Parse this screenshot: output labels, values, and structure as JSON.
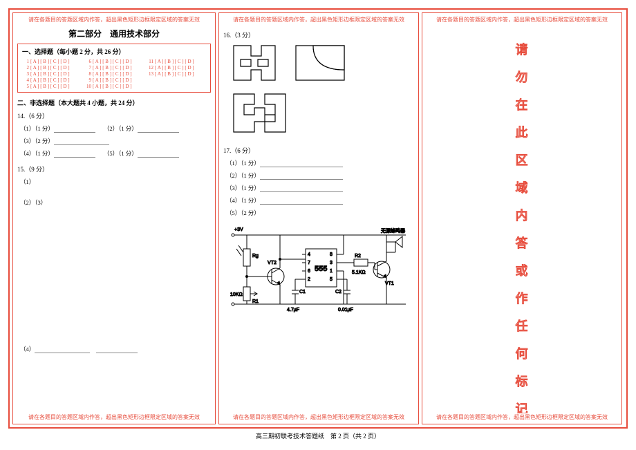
{
  "warn_text": "请在各题目的答题区域内作答，超出黑色矩形边框限定区域的答案无效",
  "panel1": {
    "section_title": "第二部分　通用技术部分",
    "mc_title": "一、选择题（每小题 2 分，共 26 分）",
    "option_bubble": "[ A ] [ B ] [ C ] [ D ]",
    "numbers": [
      "1",
      "2",
      "3",
      "4",
      "5",
      "6",
      "7",
      "8",
      "9",
      "10",
      "11",
      "12",
      "13"
    ],
    "sub_title": "二、非选择题（本大题共 4 小题，共 24 分）",
    "q14": "14.（6 分）",
    "q14_1a": "（1）（1 分）",
    "q14_1b": "（2）（1 分）",
    "q14_2": "（3）（2 分）",
    "q14_3a": "（4）（1 分）",
    "q14_3b": "（5）（1 分）",
    "q15": "15.（9 分）",
    "q15_1": "（1）",
    "q15_2": "（2）（3）",
    "q15_4": "（4）"
  },
  "panel2": {
    "q16": "16.（3 分）",
    "q17": "17.（6 分）",
    "q17_1": "（1）（1 分）",
    "q17_2": "（2）（1 分）",
    "q17_3": "（3）（1 分）",
    "q17_4": "（4）（1 分）",
    "q17_5": "（5）（2 分）",
    "circuit": {
      "v3": "+3V",
      "rg": "Rg",
      "vt2": "VT2",
      "r1": "R1",
      "r1v": "10KΩ",
      "ic": "555",
      "pins": [
        "1",
        "2",
        "3",
        "4",
        "5",
        "6",
        "7",
        "8"
      ],
      "c1": "C1",
      "c1v": "4.7µF",
      "c2": "C2",
      "c2v": "0.01µF",
      "r2": "R2",
      "r2v": "5.1KΩ",
      "vt1": "VT1",
      "buzzer": "无源蜂鸣器"
    }
  },
  "panel3": {
    "vertical_chars": [
      "请",
      "勿",
      "在",
      "此",
      "区",
      "域",
      "内",
      "答",
      "或",
      "作",
      "任",
      "何",
      "标",
      "记"
    ]
  },
  "footer": "高三期初联考技术答题纸　第 2 页（共 2 页）"
}
